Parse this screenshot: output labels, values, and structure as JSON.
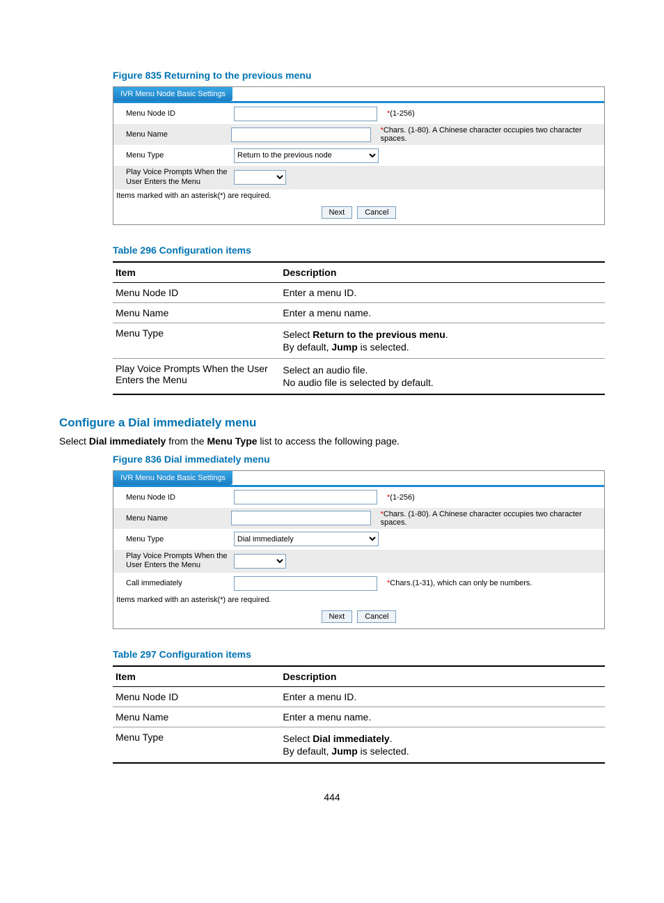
{
  "fig835": {
    "caption": "Figure 835 Returning to the previous menu",
    "header": "IVR Menu Node Basic Settings",
    "rows": {
      "menuNodeId": {
        "label": "Menu Node ID",
        "hintPrefix": "*",
        "hint": "(1-256)"
      },
      "menuName": {
        "label": "Menu Name",
        "hintPrefix": "*",
        "hint": "Chars. (1-80). A Chinese character occupies two character spaces."
      },
      "menuType": {
        "label": "Menu Type",
        "selected": "Return to the previous node"
      },
      "playPrompt": {
        "label": "Play Voice Prompts When the User Enters the Menu"
      }
    },
    "note": "Items marked with an asterisk(*) are required.",
    "next": "Next",
    "cancel": "Cancel"
  },
  "table296": {
    "caption": "Table 296 Configuration items",
    "headers": {
      "item": "Item",
      "desc": "Description"
    },
    "rows": [
      {
        "item": "Menu Node ID",
        "desc": [
          "Enter a menu ID."
        ]
      },
      {
        "item": "Menu Name",
        "desc": [
          "Enter a menu name."
        ]
      },
      {
        "item": "Menu Type",
        "desc_rich": [
          {
            "pre": "Select ",
            "bold": "Return to the previous menu",
            "post": "."
          },
          {
            "pre": "By default, ",
            "bold": "Jump",
            "post": " is selected."
          }
        ]
      },
      {
        "item": "Play Voice Prompts When the User Enters the Menu",
        "desc": [
          "Select an audio file.",
          "No audio file is selected by default."
        ]
      }
    ]
  },
  "section2": {
    "heading": "Configure a Dial immediately menu",
    "intro_pre": "Select ",
    "intro_b1": "Dial immediately",
    "intro_mid": " from the ",
    "intro_b2": "Menu Type",
    "intro_post": " list to access the following page."
  },
  "fig836": {
    "caption": "Figure 836 Dial immediately menu",
    "header": "IVR Menu Node Basic Settings",
    "rows": {
      "menuNodeId": {
        "label": "Menu Node ID",
        "hintPrefix": "*",
        "hint": "(1-256)"
      },
      "menuName": {
        "label": "Menu Name",
        "hintPrefix": "*",
        "hint": "Chars. (1-80). A Chinese character occupies two character spaces."
      },
      "menuType": {
        "label": "Menu Type",
        "selected": "Dial immediately"
      },
      "playPrompt": {
        "label": "Play Voice Prompts When the User Enters the Menu"
      },
      "callImm": {
        "label": "Call immediately",
        "hintPrefix": "*",
        "hint": "Chars.(1-31), which can only be numbers."
      }
    },
    "note": "Items marked with an asterisk(*) are required.",
    "next": "Next",
    "cancel": "Cancel"
  },
  "table297": {
    "caption": "Table 297 Configuration items",
    "headers": {
      "item": "Item",
      "desc": "Description"
    },
    "rows": [
      {
        "item": "Menu Node ID",
        "desc": [
          "Enter a menu ID."
        ]
      },
      {
        "item": "Menu Name",
        "desc": [
          "Enter a menu name."
        ]
      },
      {
        "item": "Menu Type",
        "desc_rich": [
          {
            "pre": "Select ",
            "bold": "Dial immediately",
            "post": "."
          },
          {
            "pre": "By default, ",
            "bold": "Jump",
            "post": " is selected."
          }
        ]
      }
    ]
  },
  "pageNum": "444"
}
